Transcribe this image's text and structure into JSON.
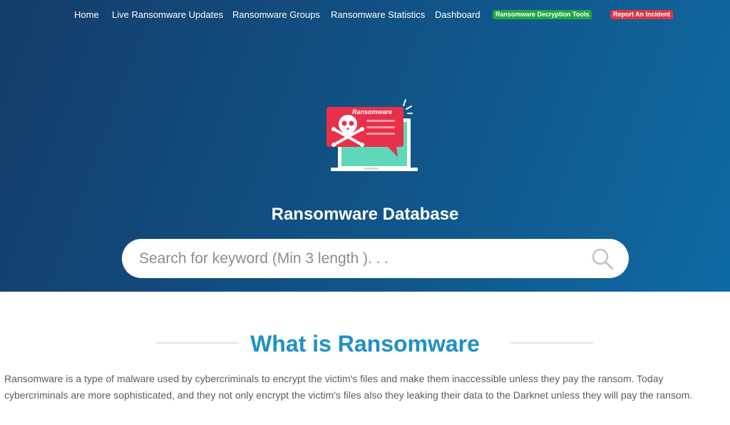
{
  "nav": {
    "items": [
      {
        "label": "Home"
      },
      {
        "label": "Live Ransomware Updates"
      },
      {
        "label": "Ransomware Groups"
      },
      {
        "label": "Ransomware Statistics"
      },
      {
        "label": "Dashboard"
      }
    ],
    "decryption_tools": "Ransomware Decryption Tools",
    "report_incident": "Report An Incident"
  },
  "hero": {
    "illustration_label": "Ransomware",
    "title": "Ransomware Database",
    "search_placeholder": "Search for keyword (Min 3 length ). . ."
  },
  "section": {
    "title": "What is Ransomware",
    "description": "Ransomware is a type of malware used by cybercriminals to encrypt the victim's files and make them inaccessible unless they pay the ransom. Today cybercriminals are more sophisticated, and they not only encrypt the victim's files also they leaking their data to the Darknet unless they will pay the ransom."
  },
  "colors": {
    "hero_gradient_start": "#143d6a",
    "hero_gradient_end": "#0f6aa3",
    "badge_green": "#22a744",
    "badge_red": "#dc3545",
    "section_title": "#1e90c9",
    "illustration_red": "#e8304a",
    "illustration_screen": "#5fd8b9"
  },
  "icons": {
    "search": "search-icon",
    "skull": "skull-crossbones-icon"
  }
}
